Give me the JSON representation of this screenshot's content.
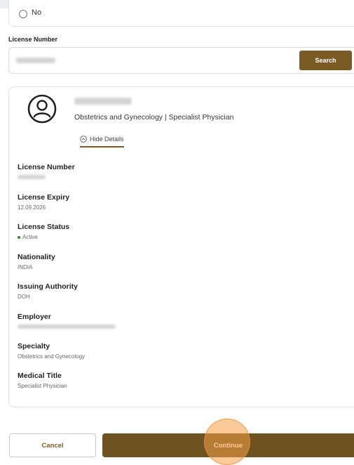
{
  "radio": {
    "option_no": "No"
  },
  "license_search": {
    "label": "License Number",
    "search_button": "Search"
  },
  "professional": {
    "subtitle": "Obstetrics and Gynecology | Specialist Physician",
    "hide_details": "Hide Details"
  },
  "details": [
    {
      "label": "License Number",
      "value": ""
    },
    {
      "label": "License Expiry",
      "value": "12.09.2026"
    },
    {
      "label": "License Status",
      "value": "Active"
    },
    {
      "label": "Nationality",
      "value": "INDIA"
    },
    {
      "label": "Issuing Authority",
      "value": "DOH"
    },
    {
      "label": "Employer",
      "value": ""
    },
    {
      "label": "Specialty",
      "value": "Obstetrics and Gynecology"
    },
    {
      "label": "Medical Title",
      "value": "Specialist Physician"
    }
  ],
  "actions": {
    "cancel": "Cancel",
    "continue": "Continue"
  },
  "colors": {
    "accent": "#7a5b23",
    "status_active": "#2e8b3a"
  },
  "icons": {
    "avatar": "user-circle-icon",
    "hide": "collapse-circle-icon"
  }
}
